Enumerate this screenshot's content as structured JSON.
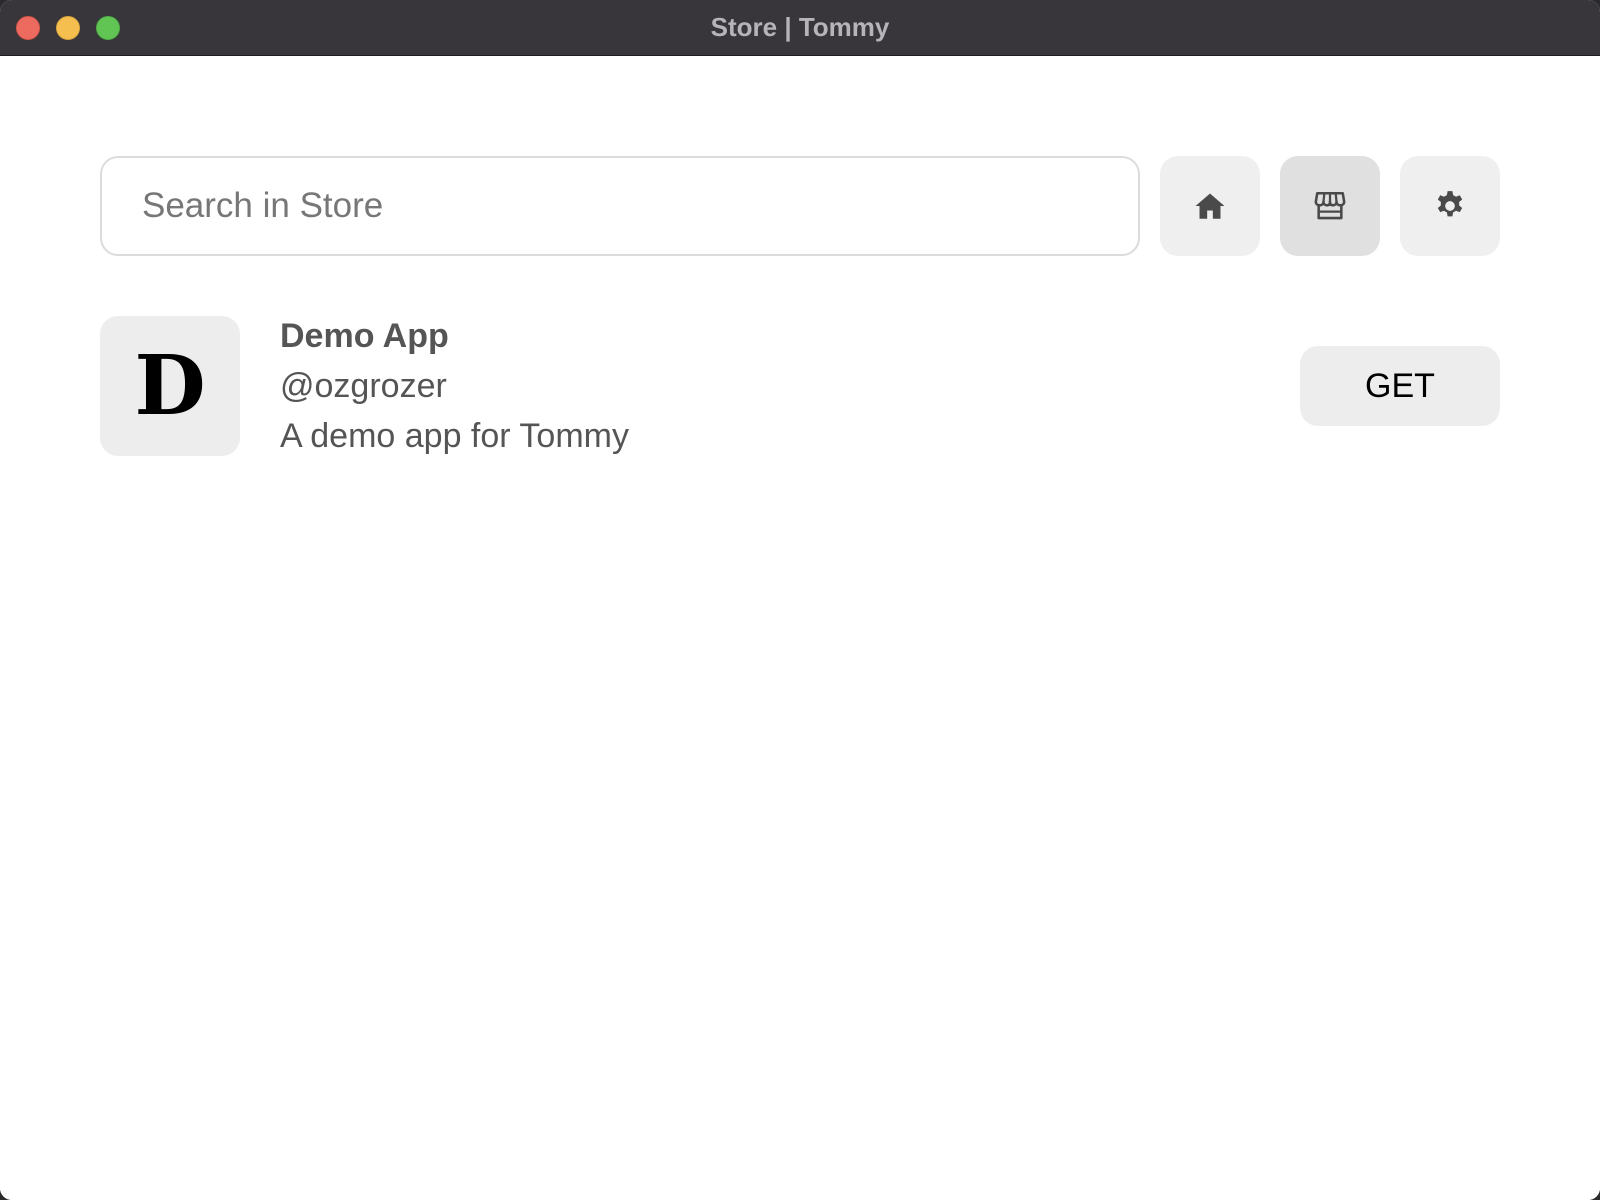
{
  "window": {
    "title": "Store | Tommy"
  },
  "search": {
    "placeholder": "Search in Store",
    "value": ""
  },
  "nav": {
    "home_icon": "home-icon",
    "store_icon": "store-icon",
    "settings_icon": "gear-icon",
    "active": "store"
  },
  "apps": [
    {
      "icon_letter": "D",
      "name": "Demo App",
      "author": "@ozgrozer",
      "description": "A demo app for Tommy",
      "action_label": "GET"
    }
  ],
  "colors": {
    "titlebar": "#38363b",
    "title_text": "#b6b4b8",
    "button_bg": "#efefef",
    "button_active_bg": "#e0e0e0",
    "text": "#555555",
    "traffic_close": "#ec6a5e",
    "traffic_minimize": "#f4bf4f",
    "traffic_zoom": "#61c554"
  }
}
